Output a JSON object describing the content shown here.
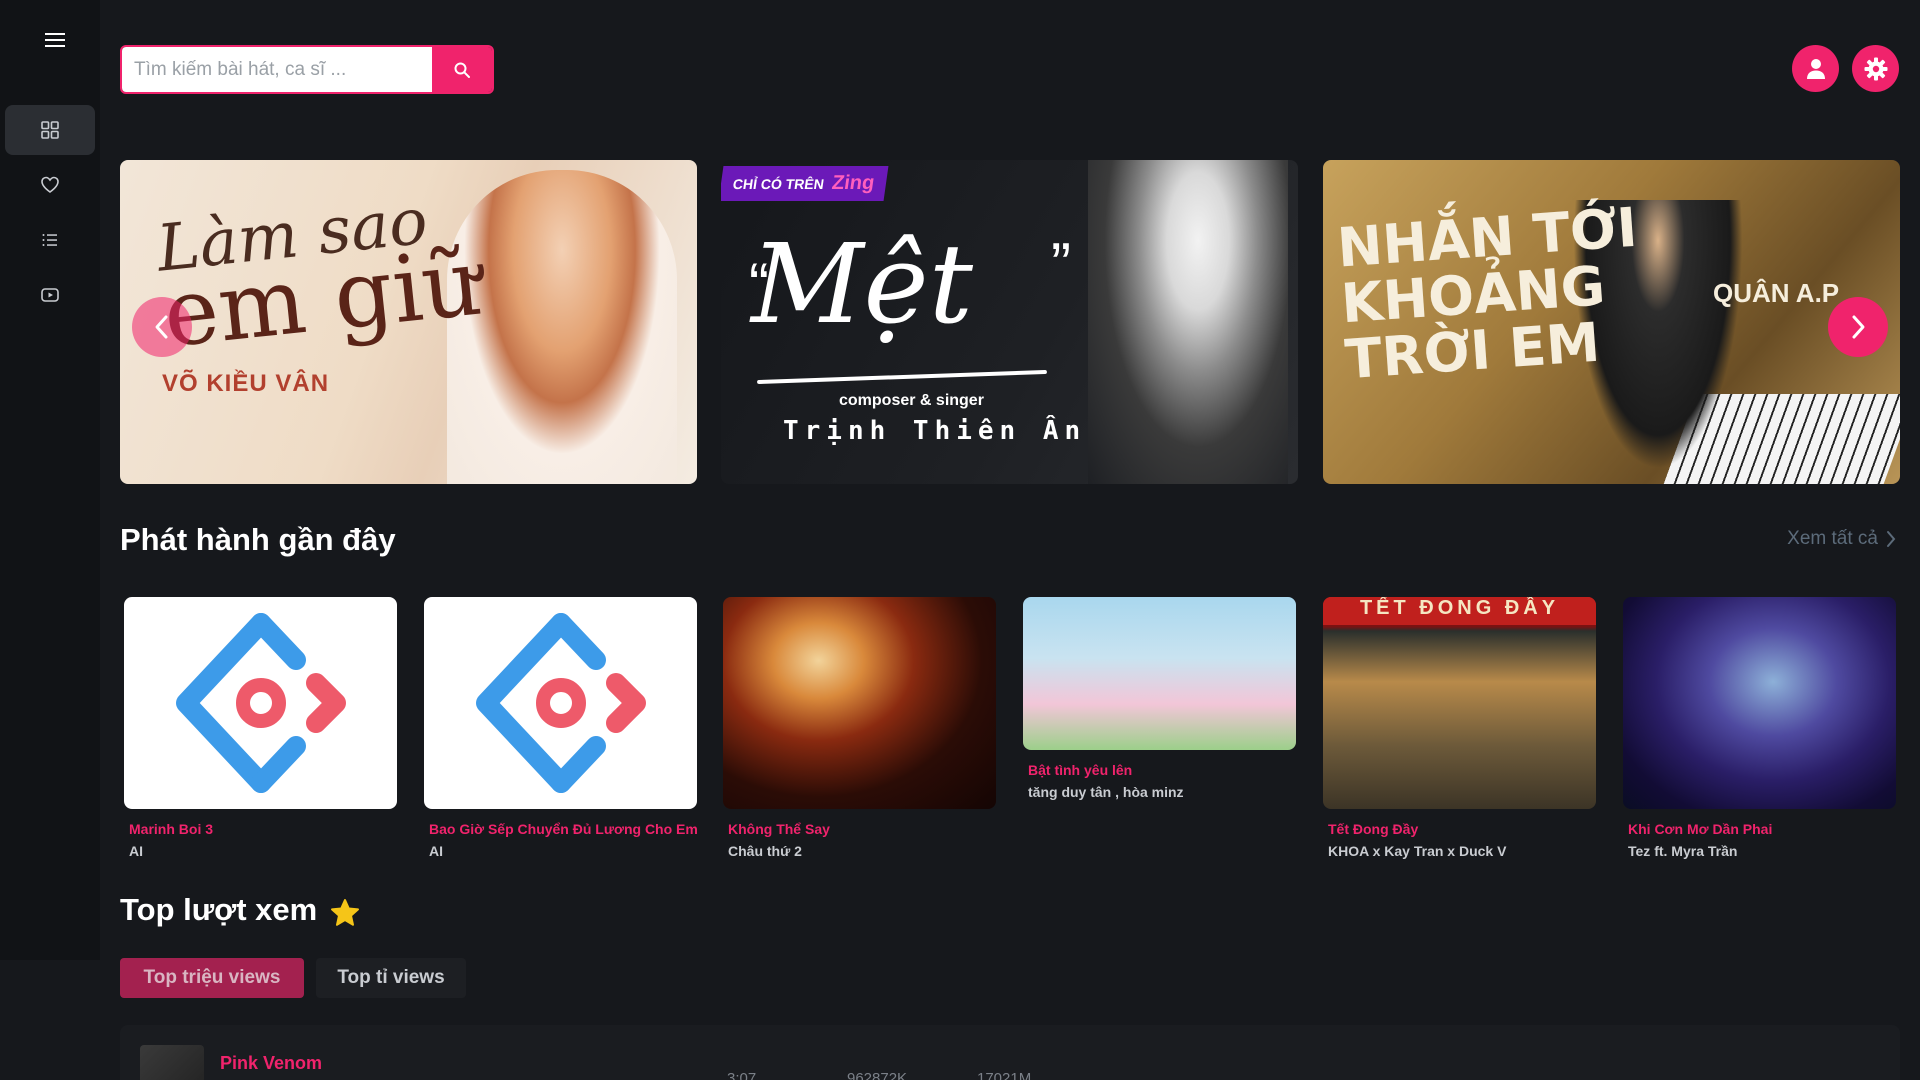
{
  "search": {
    "placeholder": "Tìm kiếm bài hát, ca sĩ ..."
  },
  "sidebar": {
    "items": [
      {
        "name": "grid-icon",
        "active": true
      },
      {
        "name": "heart-icon",
        "active": false
      },
      {
        "name": "list-icon",
        "active": false
      },
      {
        "name": "video-icon",
        "active": false
      }
    ]
  },
  "banners": [
    {
      "script_line1": "Làm sao",
      "script_line2": "em giữ",
      "artist": "VÕ KIỀU VÂN"
    },
    {
      "tag": "CHỈ CÓ TRÊN",
      "tag_brand": "Zing",
      "title": "Mệt",
      "subtitle": "composer & singer",
      "artist": "Trịnh Thiên Ân"
    },
    {
      "text_line1": "NHẮN TỚI",
      "text_line2": "KHOẢNG",
      "text_line3": "TRỜI EM",
      "side_text": "QUÂN A.P"
    }
  ],
  "recent": {
    "title": "Phát hành gần đây",
    "see_all": "Xem tất cả",
    "cards": [
      {
        "title": "Marinh Boi 3",
        "artist": "AI"
      },
      {
        "title": "Bao Giờ Sếp Chuyển Đủ Lương Cho Em",
        "artist": "AI"
      },
      {
        "title": "Không Thể Say",
        "artist": "Châu thứ 2"
      },
      {
        "title": "Bật tình yêu lên",
        "artist": "tăng duy tân , hòa minz"
      },
      {
        "title": "Tết Đong Đầy",
        "artist": "KHOA x Kay Tran x Duck V",
        "band_text": "TẾT ĐONG ĐẦY"
      },
      {
        "title": "Khi Cơn Mơ Dần Phai",
        "artist": "Tez ft. Myra Trần"
      }
    ]
  },
  "top": {
    "title": "Top lượt xem",
    "tabs": [
      "Top triệu views",
      "Top tỉ views"
    ],
    "songs": [
      {
        "name": "Pink Venom",
        "duration": "3:07",
        "views": "962872K",
        "likes": "17021M"
      }
    ]
  },
  "colors": {
    "accent": "#f0236c",
    "background": "#16181c",
    "sidebar": "#111316"
  }
}
